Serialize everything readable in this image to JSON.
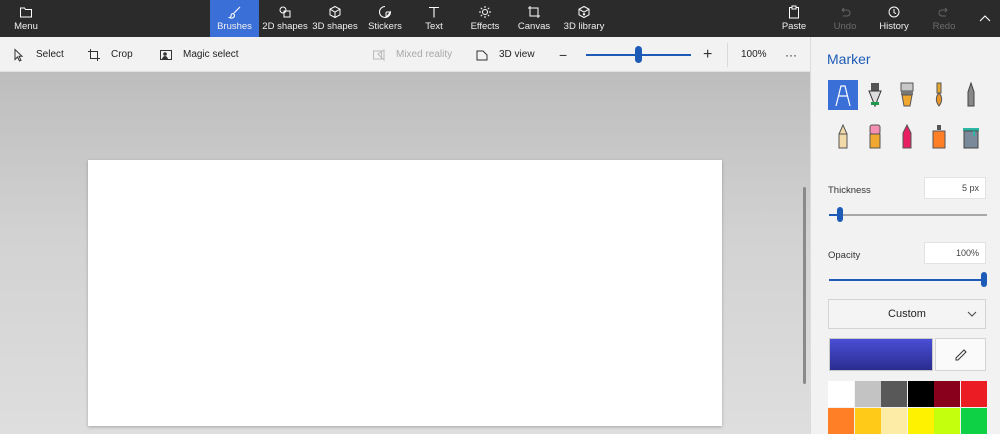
{
  "ribbon": {
    "menu": "Menu",
    "tabs": [
      {
        "label": "Brushes",
        "icon": "brush-icon",
        "active": true
      },
      {
        "label": "2D shapes",
        "icon": "2d-shapes-icon"
      },
      {
        "label": "3D shapes",
        "icon": "3d-shapes-icon"
      },
      {
        "label": "Stickers",
        "icon": "stickers-icon"
      },
      {
        "label": "Text",
        "icon": "text-icon"
      },
      {
        "label": "Effects",
        "icon": "effects-icon"
      },
      {
        "label": "Canvas",
        "icon": "canvas-icon"
      },
      {
        "label": "3D library",
        "icon": "3d-library-icon"
      }
    ],
    "paste": "Paste",
    "undo": "Undo",
    "history": "History",
    "redo": "Redo"
  },
  "toolbar": {
    "select": "Select",
    "crop": "Crop",
    "magic_select": "Magic select",
    "mixed_reality": "Mixed reality",
    "view_3d": "3D view",
    "zoom_minus": "−",
    "zoom_plus": "+",
    "zoom_level": "100%",
    "zoom_fraction": 0.5,
    "more": "···"
  },
  "panel": {
    "title": "Marker",
    "brushes": [
      "marker-icon",
      "calligraphy-pen-icon",
      "oil-brush-icon",
      "watercolor-icon",
      "pixel-pen-icon",
      "pencil-icon",
      "eraser-icon",
      "crayon-icon",
      "spray-can-icon",
      "fill-icon"
    ],
    "thickness_label": "Thickness",
    "thickness_value": "5 px",
    "thickness_fraction": 0.05,
    "opacity_label": "Opacity",
    "opacity_value": "100%",
    "opacity_fraction": 1.0,
    "color_mode": "Custom",
    "current_color": "#3a3dc0",
    "palette_row1": [
      "#ffffff",
      "#c3c3c3",
      "#585858",
      "#000000",
      "#88001b",
      "#ec1c24"
    ],
    "palette_row2": [
      "#ff7f27",
      "#ffca18",
      "#fdeca6",
      "#fff200",
      "#c4ff0e",
      "#0ed145"
    ]
  },
  "colors": {
    "accent": "#3a6fd8",
    "accent_dark": "#1d5bb6",
    "ribbon_bg": "#2b2b2b"
  }
}
